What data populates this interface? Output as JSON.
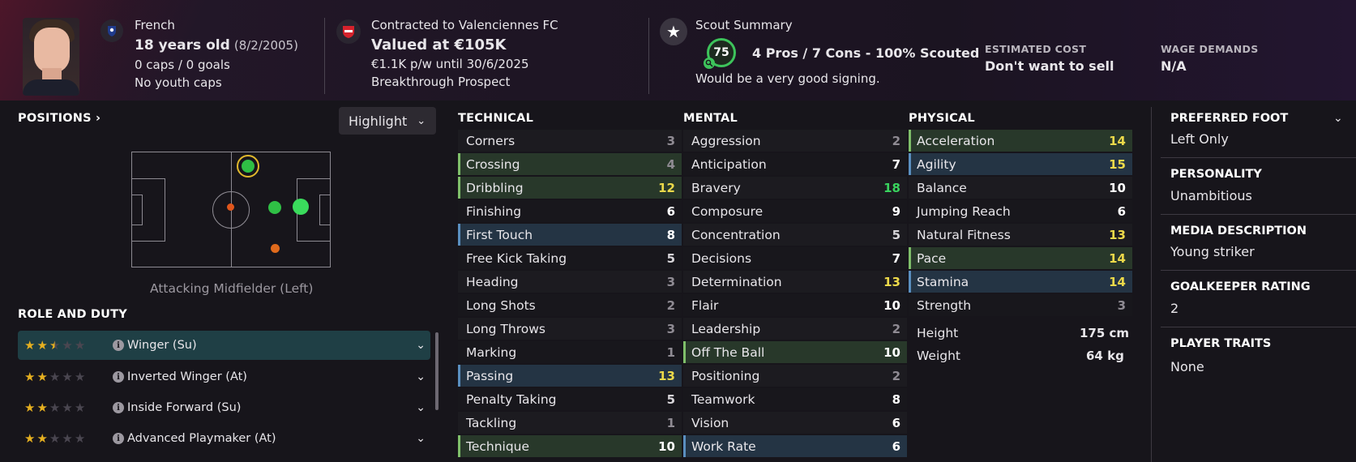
{
  "header": {
    "nationality": "French",
    "age": "18 years old",
    "dob": "(8/2/2005)",
    "caps_goals": "0 caps / 0 goals",
    "youth_caps": "No youth caps",
    "contract_label": "Contracted to Valenciennes FC",
    "value": "Valued at €105K",
    "wage_contract": "€1.1K p/w until 30/6/2025",
    "prospect": "Breakthrough Prospect",
    "scout_title": "Scout Summary",
    "scout_score": "75",
    "scout_summary": "4 Pros / 7 Cons - 100% Scouted",
    "scout_note": "Would be a very good signing.",
    "estimated_cost_label": "ESTIMATED COST",
    "estimated_cost": "Don't want to sell",
    "wage_demands_label": "WAGE DEMANDS",
    "wage_demands": "N/A"
  },
  "positions": {
    "title": "POSITIONS",
    "highlight_label": "Highlight",
    "position_label": "Attacking Midfielder (Left)"
  },
  "roles": {
    "title": "ROLE AND DUTY",
    "items": [
      {
        "label": "Winger (Su)",
        "stars": 2.5,
        "selected": true
      },
      {
        "label": "Inverted Winger (At)",
        "stars": 2,
        "selected": false
      },
      {
        "label": "Inside Forward (Su)",
        "stars": 2,
        "selected": false
      },
      {
        "label": "Advanced Playmaker (At)",
        "stars": 2,
        "selected": false
      }
    ]
  },
  "technical": {
    "title": "TECHNICAL",
    "rows": [
      {
        "name": "Corners",
        "value": "3",
        "hl": ""
      },
      {
        "name": "Crossing",
        "value": "4",
        "hl": "green"
      },
      {
        "name": "Dribbling",
        "value": "12",
        "hl": "green"
      },
      {
        "name": "Finishing",
        "value": "6",
        "hl": ""
      },
      {
        "name": "First Touch",
        "value": "8",
        "hl": "blue"
      },
      {
        "name": "Free Kick Taking",
        "value": "5",
        "hl": ""
      },
      {
        "name": "Heading",
        "value": "3",
        "hl": ""
      },
      {
        "name": "Long Shots",
        "value": "2",
        "hl": ""
      },
      {
        "name": "Long Throws",
        "value": "3",
        "hl": ""
      },
      {
        "name": "Marking",
        "value": "1",
        "hl": ""
      },
      {
        "name": "Passing",
        "value": "13",
        "hl": "blue"
      },
      {
        "name": "Penalty Taking",
        "value": "5",
        "hl": ""
      },
      {
        "name": "Tackling",
        "value": "1",
        "hl": ""
      },
      {
        "name": "Technique",
        "value": "10",
        "hl": "green"
      }
    ]
  },
  "mental": {
    "title": "MENTAL",
    "rows": [
      {
        "name": "Aggression",
        "value": "2",
        "hl": ""
      },
      {
        "name": "Anticipation",
        "value": "7",
        "hl": ""
      },
      {
        "name": "Bravery",
        "value": "18",
        "hl": ""
      },
      {
        "name": "Composure",
        "value": "9",
        "hl": ""
      },
      {
        "name": "Concentration",
        "value": "5",
        "hl": ""
      },
      {
        "name": "Decisions",
        "value": "7",
        "hl": ""
      },
      {
        "name": "Determination",
        "value": "13",
        "hl": ""
      },
      {
        "name": "Flair",
        "value": "10",
        "hl": ""
      },
      {
        "name": "Leadership",
        "value": "2",
        "hl": ""
      },
      {
        "name": "Off The Ball",
        "value": "10",
        "hl": "green"
      },
      {
        "name": "Positioning",
        "value": "2",
        "hl": ""
      },
      {
        "name": "Teamwork",
        "value": "8",
        "hl": ""
      },
      {
        "name": "Vision",
        "value": "6",
        "hl": ""
      },
      {
        "name": "Work Rate",
        "value": "6",
        "hl": "blue"
      }
    ]
  },
  "physical": {
    "title": "PHYSICAL",
    "rows": [
      {
        "name": "Acceleration",
        "value": "14",
        "hl": "green"
      },
      {
        "name": "Agility",
        "value": "15",
        "hl": "blue"
      },
      {
        "name": "Balance",
        "value": "10",
        "hl": ""
      },
      {
        "name": "Jumping Reach",
        "value": "6",
        "hl": ""
      },
      {
        "name": "Natural Fitness",
        "value": "13",
        "hl": ""
      },
      {
        "name": "Pace",
        "value": "14",
        "hl": "green"
      },
      {
        "name": "Stamina",
        "value": "14",
        "hl": "blue"
      },
      {
        "name": "Strength",
        "value": "3",
        "hl": ""
      }
    ],
    "height_label": "Height",
    "height": "175 cm",
    "weight_label": "Weight",
    "weight": "64 kg"
  },
  "info": {
    "preferred_foot_label": "PREFERRED FOOT",
    "preferred_foot": "Left Only",
    "personality_label": "PERSONALITY",
    "personality": "Unambitious",
    "media_label": "MEDIA DESCRIPTION",
    "media": "Young striker",
    "gk_label": "GOALKEEPER RATING",
    "gk": "2",
    "traits_label": "PLAYER TRAITS",
    "traits": "None"
  },
  "colors": {
    "green_highlight": "#28382a",
    "blue_highlight": "#243444",
    "yellow_value": "#ecd94a",
    "green_value": "#39d35e",
    "selected_role": "#1f3f45"
  }
}
